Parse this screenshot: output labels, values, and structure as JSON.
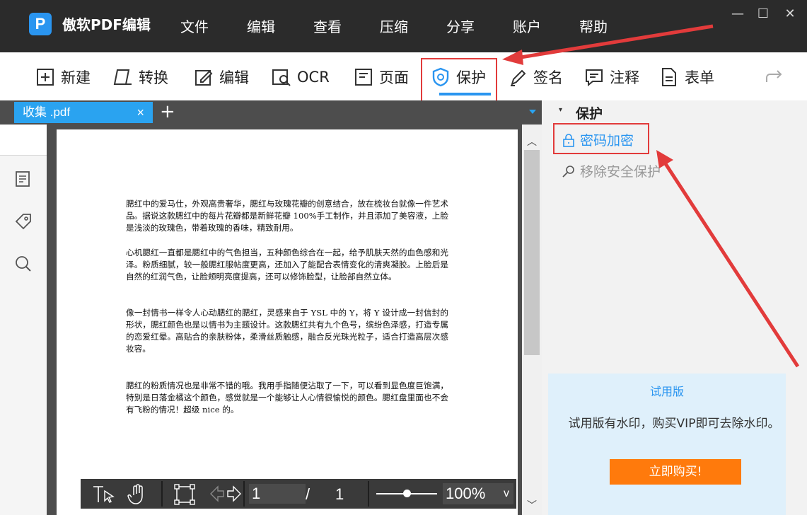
{
  "app": {
    "logo": "P",
    "title": "傲软PDF编辑"
  },
  "menu": [
    "文件",
    "编辑",
    "查看",
    "压缩",
    "分享",
    "账户",
    "帮助"
  ],
  "window_controls": {
    "minimize": "—",
    "maximize": "☐",
    "close": "✕"
  },
  "toolbar": {
    "new": "新建",
    "convert": "转换",
    "edit": "编辑",
    "ocr": "OCR",
    "page": "页面",
    "protect": "保护",
    "sign": "签名",
    "annotate": "注释",
    "form": "表单"
  },
  "tabs": {
    "file_name": "收集 .pdf",
    "close": "×",
    "add": "+"
  },
  "document": {
    "paragraphs": [
      "腮红中的爱马仕，外观高贵奢华，腮红与玫瑰花瓣的创意结合，放在梳妆台就像一件艺术品。据说这款腮红中的每片花瓣都是新鲜花瓣 100%手工制作，并且添加了美容液，上脸是浅淡的玫瑰色，带着玫瑰的香味，精致耐用。",
      "心机腮红一直都是腮红中的气色担当，五种颜色综合在一起，给予肌肤天然的血色感和光泽。粉质细腻，较一般腮红服帖度更高，还加入了能配合表情变化的清爽凝胶。上脸后是自然的红润气色，让脸颊明亮度提高，还可以修饰脸型，让脸部自然立体。",
      "像一封情书一样令人心动腮红的腮红，灵感来自于 YSL 中的 Y，将 Y 设计成一封信封的形状，腮红颜色也是以情书为主题设计。这款腮红共有九个色号，缤纷色泽感，打造专属的恋爱红晕。高贴合的亲肤粉体，柔滑丝质触感，融合反光珠光粒子，适合打造高层次感妆容。",
      "腮红的粉质情况也是非常不错的哦。我用手指随便沾取了一下，可以看到显色度巨饱满，特别是日落金橘这个颜色，感觉就是一个能够让人心情很愉悦的颜色。腮红盘里面也不会有飞粉的情况！超级 nice 的。"
    ]
  },
  "bottom_bar": {
    "current_page": "1",
    "separator": "/",
    "total_pages": "1",
    "zoom": "100%",
    "zoom_dropdown": "v",
    "zoom_level": 0.5
  },
  "right_panel": {
    "caret": "▾",
    "title": "保护",
    "password_encrypt": "密码加密",
    "remove_security": "移除安全保护",
    "trial_title": "试用版",
    "trial_text": "试用版有水印，购买VIP即可去除水印。",
    "buy_button": "立即购买!"
  },
  "colors": {
    "accent": "#2a95f0",
    "annotation": "#e23b3b",
    "buy": "#ff7a0c",
    "titlebar": "#2b2b2b"
  }
}
